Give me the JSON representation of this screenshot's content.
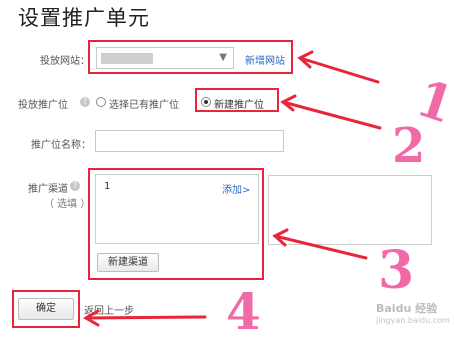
{
  "page": {
    "title": "设置推广单元"
  },
  "site": {
    "label": "投放网站：",
    "new_site_link": "新增网站"
  },
  "position": {
    "label": "投放推广位",
    "help_icon": "question-circle-icon",
    "option_existing": "选择已有推广位",
    "option_new": "新建推广位",
    "selected": "新建推广位"
  },
  "position_name": {
    "label": "推广位名称：",
    "value": ""
  },
  "channel": {
    "label": "推广渠道",
    "optional_note": "（ 选填 ）",
    "help_icon": "question-circle-icon",
    "list_item": "1",
    "add_link": "添加>",
    "new_channel_button": "新建渠道"
  },
  "actions": {
    "confirm_button": "确定",
    "back_link": "返回上一步"
  },
  "annotations": {
    "color": "#e8263a",
    "number_color": "#f06aa8",
    "numbers": [
      "1",
      "2",
      "3",
      "4"
    ]
  },
  "watermark": {
    "text": "Baidu 经验",
    "sub": "jingyan.baidu.com"
  }
}
